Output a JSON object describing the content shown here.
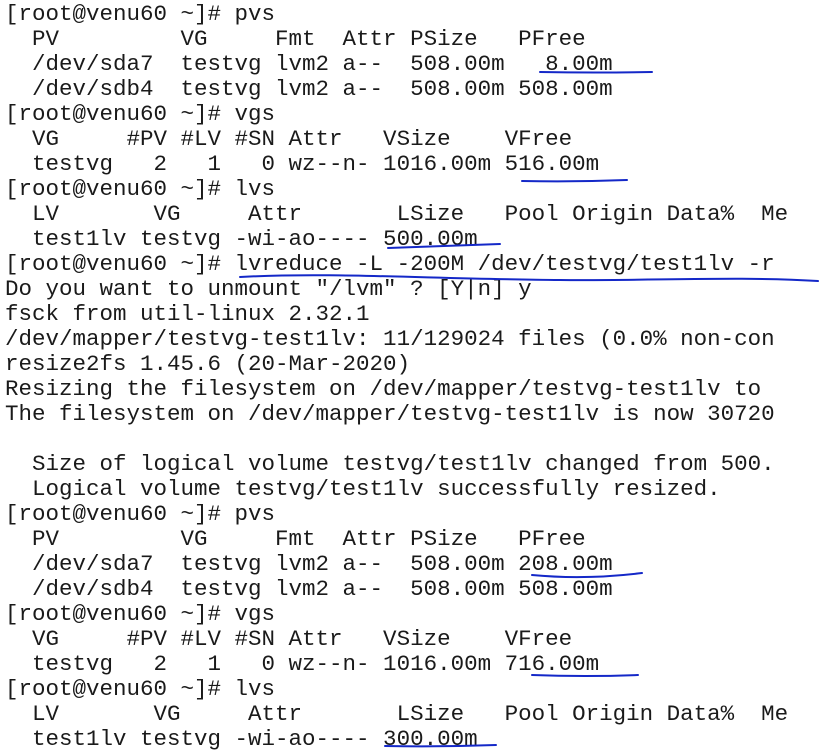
{
  "terminal": {
    "lines": [
      "[root@venu60 ~]# pvs",
      "  PV         VG     Fmt  Attr PSize   PFree",
      "  /dev/sda7  testvg lvm2 a--  508.00m   8.00m",
      "  /dev/sdb4  testvg lvm2 a--  508.00m 508.00m",
      "[root@venu60 ~]# vgs",
      "  VG     #PV #LV #SN Attr   VSize    VFree",
      "  testvg   2   1   0 wz--n- 1016.00m 516.00m",
      "[root@venu60 ~]# lvs",
      "  LV       VG     Attr       LSize   Pool Origin Data%  Me",
      "  test1lv testvg -wi-ao---- 500.00m",
      "[root@venu60 ~]# lvreduce -L -200M /dev/testvg/test1lv -r",
      "Do you want to unmount \"/lvm\" ? [Y|n] y",
      "fsck from util-linux 2.32.1",
      "/dev/mapper/testvg-test1lv: 11/129024 files (0.0% non-con",
      "resize2fs 1.45.6 (20-Mar-2020)",
      "Resizing the filesystem on /dev/mapper/testvg-test1lv to",
      "The filesystem on /dev/mapper/testvg-test1lv is now 30720",
      "",
      "  Size of logical volume testvg/test1lv changed from 500.",
      "  Logical volume testvg/test1lv successfully resized.",
      "[root@venu60 ~]# pvs",
      "  PV         VG     Fmt  Attr PSize   PFree",
      "  /dev/sda7  testvg lvm2 a--  508.00m 208.00m",
      "  /dev/sdb4  testvg lvm2 a--  508.00m 508.00m",
      "[root@venu60 ~]# vgs",
      "  VG     #PV #LV #SN Attr   VSize    VFree",
      "  testvg   2   1   0 wz--n- 1016.00m 716.00m",
      "[root@venu60 ~]# lvs",
      "  LV       VG     Attr       LSize   Pool Origin Data%  Me",
      "  test1lv testvg -wi-ao---- 300.00m"
    ]
  },
  "annotation_color": "#1428c8"
}
